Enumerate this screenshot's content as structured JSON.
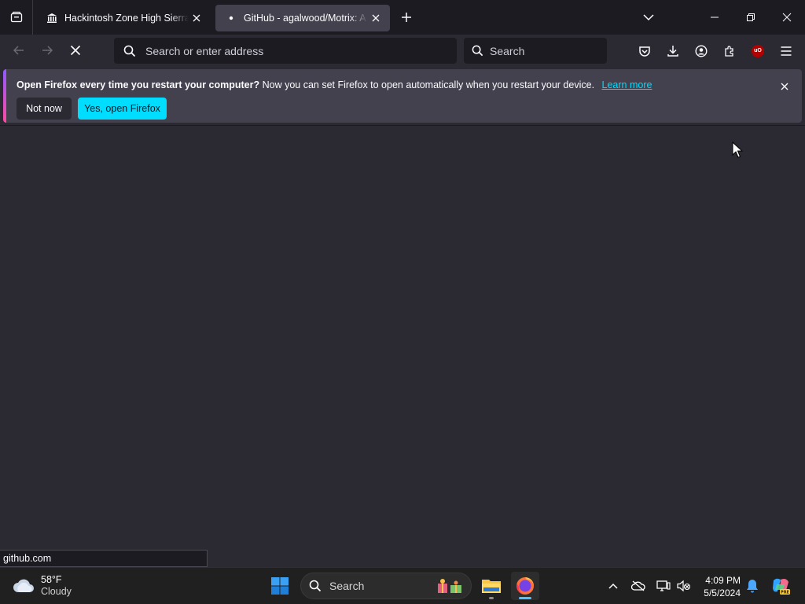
{
  "tabs": [
    {
      "title": "Hackintosh Zone High Sierra Installer",
      "active": false
    },
    {
      "title": "GitHub - agalwood/Motrix: A full-featured download manager",
      "active": true
    }
  ],
  "navbar": {
    "url_placeholder": "Search or enter address",
    "search_placeholder": "Search"
  },
  "notification": {
    "headline": "Open Firefox every time you restart your computer?",
    "body": "Now you can set Firefox to open automatically when you restart your device.",
    "link": "Learn more",
    "not_now_label": "Not now",
    "yes_label": "Yes, open Firefox"
  },
  "status": {
    "text": "github.com"
  },
  "taskbar": {
    "weather_temp": "58°F",
    "weather_condition": "Cloudy",
    "search_label": "Search",
    "time": "4:09 PM",
    "date": "5/5/2024"
  },
  "colors": {
    "accent": "#00ddff",
    "chrome_bg": "#1c1b22",
    "toolbar_bg": "#2b2a33",
    "notification_bg": "#42414d"
  },
  "icons": [
    "tab-list-icon",
    "museum-icon",
    "loading-dot-icon",
    "close-icon",
    "plus-icon",
    "chevron-down-icon",
    "minimize-icon",
    "restore-icon",
    "back-icon",
    "forward-icon",
    "stop-icon",
    "search-icon",
    "pocket-icon",
    "download-icon",
    "account-icon",
    "extensions-icon",
    "ublock-icon",
    "hamburger-menu-icon"
  ]
}
